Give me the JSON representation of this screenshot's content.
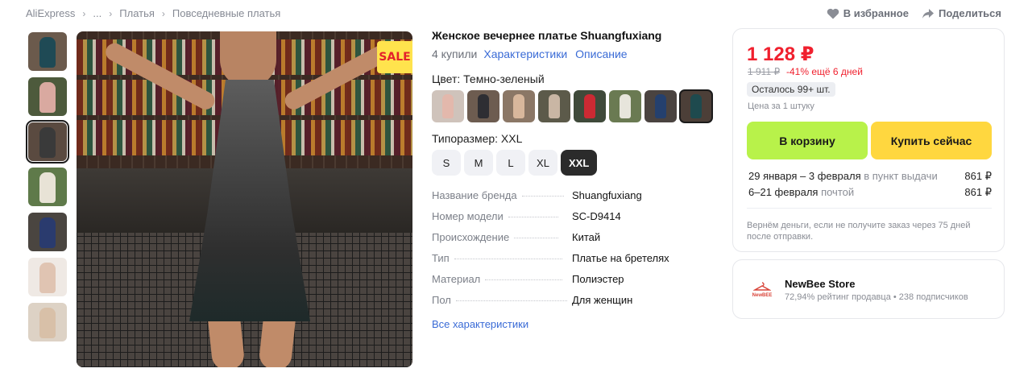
{
  "breadcrumb": {
    "items": [
      "AliExpress",
      "...",
      "Платья",
      "Повседневные платья"
    ]
  },
  "top_actions": {
    "favorite": "В избранное",
    "share": "Поделиться"
  },
  "gallery": {
    "sale_badge": "SALE",
    "thumb_colors": [
      "#1f4a55",
      "#d9a9a0",
      "#3a3a3a",
      "#e8e3d6",
      "#2a3b6e",
      "#e0c4b2",
      "#d8c0a8"
    ]
  },
  "product": {
    "title": "Женское вечернее платье Shuangfuxiang",
    "bought": "4 купили",
    "characteristics_link": "Характеристики",
    "description_link": "Описание",
    "color_label": "Цвет: Темно-зеленый",
    "swatch_colors": [
      "#e3b8ac",
      "#2e2e33",
      "#d8b79c",
      "#c9b6a4",
      "#cc2a33",
      "#e7e5dc",
      "#24406e",
      "#1e4a4e"
    ],
    "size_label": "Типоразмер: XXL",
    "sizes": [
      "S",
      "M",
      "L",
      "XL",
      "XXL"
    ],
    "selected_size": "XXL",
    "specs": [
      {
        "key": "Название бренда",
        "value": "Shuangfuxiang"
      },
      {
        "key": "Номер модели",
        "value": "SC-D9414"
      },
      {
        "key": "Происхождение",
        "value": "Китай"
      },
      {
        "key": "Тип",
        "value": "Платье на бретелях"
      },
      {
        "key": "Материал",
        "value": "Полиэстер"
      },
      {
        "key": "Пол",
        "value": "Для женщин"
      }
    ],
    "all_specs_link": "Все характеристики"
  },
  "price_card": {
    "price": "1 128 ₽",
    "old_price": "1 911 ₽",
    "discount": "-41% ещё 6 дней",
    "stock": "Осталось 99+ шт.",
    "per_unit": "Цена за 1 штуку",
    "cart_button": "В корзину",
    "buy_button": "Купить сейчас",
    "delivery": [
      {
        "dates": "29 января – 3 февраля",
        "method": "в пункт выдачи",
        "price": "861 ₽"
      },
      {
        "dates": "6–21 февраля",
        "method": "почтой",
        "price": "861 ₽"
      }
    ],
    "refund_note": "Вернём деньги, если не получите заказ через 75 дней после отправки.",
    "accent_colors": {
      "price": "#f0202e",
      "cart": "#b8f24a",
      "buy": "#ffd73f"
    }
  },
  "store": {
    "logo_text": "NewBEE",
    "name": "NewBee Store",
    "stats": "72,94% рейтинг продавца • 238 подписчиков"
  }
}
